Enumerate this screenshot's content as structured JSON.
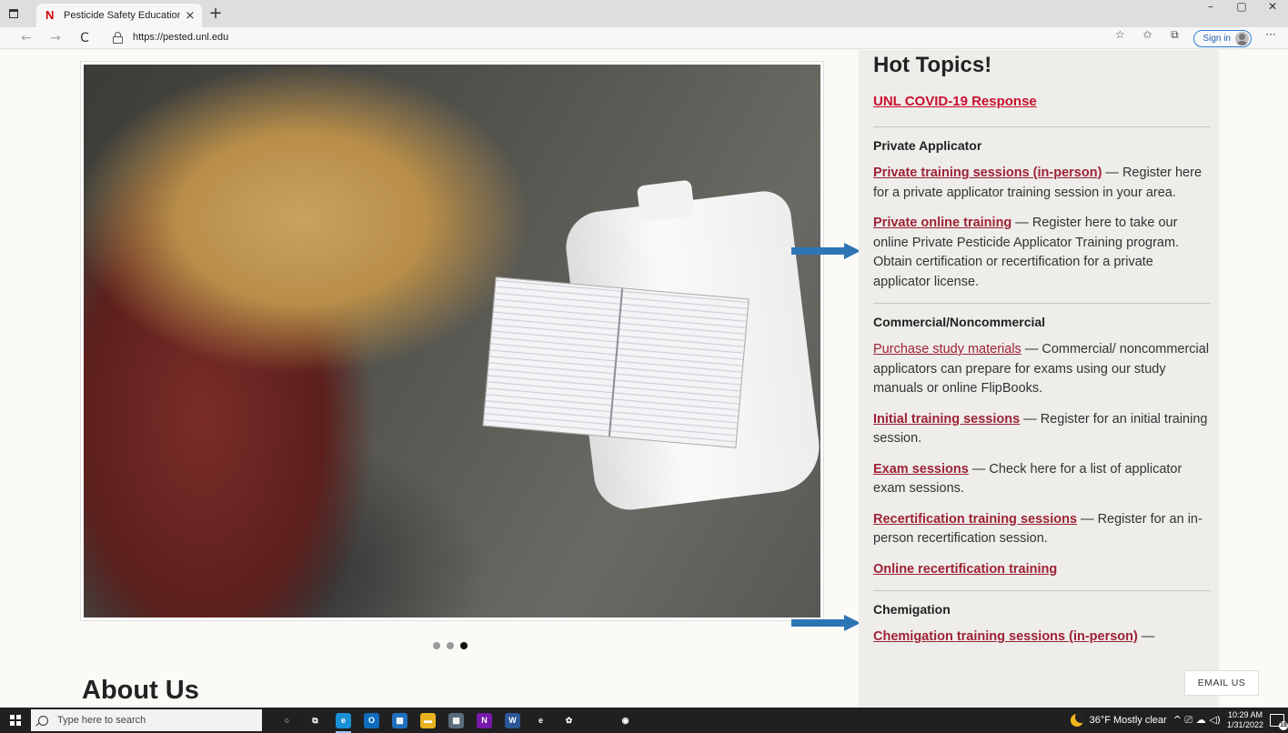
{
  "browser": {
    "tab_title": "Pesticide Safety Education Progr",
    "tab_close_glyph": "×",
    "new_tab_glyph": "+",
    "window_controls": [
      "–",
      "▢",
      "✕"
    ],
    "back_glyph": "←",
    "forward_glyph": "→",
    "reload_glyph": "C",
    "url": "https://pested.unl.edu",
    "toolbar_glyphs": [
      "☆",
      "✩",
      "⧉",
      "···"
    ],
    "signin_label": "Sign in"
  },
  "page": {
    "carousel": {
      "slide_count": 3,
      "active_index": 2
    },
    "about_heading": "About Us",
    "email_button": "EMAIL US"
  },
  "sidebar": {
    "title": "Hot Topics!",
    "covid_link": "UNL COVID-19 Response",
    "private_heading": "Private Applicator",
    "private_items": [
      {
        "link": "Private training sessions (in-person)",
        "text": " — Register here for a private applicator training session in your area."
      },
      {
        "link": "Private online training",
        "text": " — Register here to take our online Private Pesticide Applicator Training program. Obtain certification or recertification for a private applicator license."
      }
    ],
    "commercial_heading": "Commercial/Noncommercial",
    "commercial_items": [
      {
        "link": "Purchase study materials",
        "text": " — Commercial/ noncommercial applicators can prepare for exams using our study manuals or online FlipBooks."
      },
      {
        "link": "Initial training sessions",
        "text": " — Register for an initial training session."
      },
      {
        "link": "Exam sessions",
        "text": " — Check here for a list of applicator exam sessions."
      },
      {
        "link": "Recertification training sessions",
        "text": " — Register for an in-person recertification session."
      },
      {
        "link": "Online recertification training",
        "text": ""
      }
    ],
    "chemigation_heading": "Chemigation",
    "chemigation_items": [
      {
        "link": "Chemigation training sessions (in-person)",
        "text": " —"
      }
    ]
  },
  "annotations": {
    "arrow_color": "#2e75b6"
  },
  "taskbar": {
    "search_placeholder": "Type here to search",
    "weather_text": "36°F  Mostly clear",
    "tray_glyphs": "^  ⎚  ☁  ◁)",
    "time": "10:29 AM",
    "date": "1/31/2022",
    "notification_count": "18",
    "apps": [
      {
        "name": "cortana",
        "glyph": "○",
        "color": "transparent"
      },
      {
        "name": "task-view",
        "glyph": "⧉",
        "color": "transparent"
      },
      {
        "name": "edge",
        "glyph": "e",
        "color": "#1a8fd6"
      },
      {
        "name": "outlook",
        "glyph": "O",
        "color": "#0f6cbd"
      },
      {
        "name": "calendar",
        "glyph": "▦",
        "color": "#1f6fbf"
      },
      {
        "name": "file-explorer",
        "glyph": "▬",
        "color": "#e8b321"
      },
      {
        "name": "calculator",
        "glyph": "▦",
        "color": "#5b6b7a"
      },
      {
        "name": "onenote",
        "glyph": "N",
        "color": "#7719aa"
      },
      {
        "name": "word",
        "glyph": "W",
        "color": "#2b5797"
      },
      {
        "name": "internet-explorer",
        "glyph": "e",
        "color": "transparent"
      },
      {
        "name": "app-colorful",
        "glyph": "✿",
        "color": "transparent"
      },
      {
        "name": "blank",
        "glyph": "",
        "color": "transparent"
      },
      {
        "name": "chrome",
        "glyph": "◉",
        "color": "transparent"
      }
    ]
  }
}
